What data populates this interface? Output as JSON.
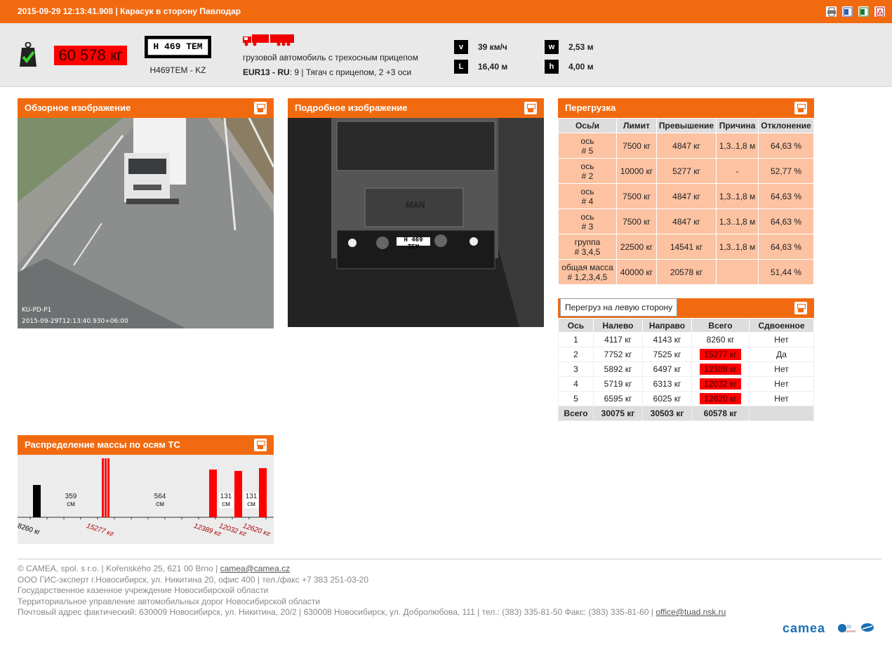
{
  "header": {
    "title": "2015-09-29 12:13:41.908 | Карасук в сторону Павлодар",
    "icons": [
      "print-icon",
      "word-icon",
      "excel-icon",
      "pdf-icon"
    ]
  },
  "vehicle": {
    "total_weight": "60 578 кг",
    "plate_text": "H 469 TEM",
    "plate_caption": "H469TEM - KZ",
    "type": "грузовой автомобиль с трехосным прицепом",
    "class_code": "EUR13 - RU",
    "class_desc": ": 9 | Тягач с прицепом, 2 +3 оси",
    "dims": {
      "v_key": "v",
      "v_val": "39 км/ч",
      "l_key": "L",
      "l_val": "16,40 м",
      "w_key": "w",
      "w_val": "2,53 м",
      "h_key": "h",
      "h_val": "4,00 м"
    }
  },
  "panels": {
    "overview_title": "Обзорное изображение",
    "detail_title": "Подробное изображение",
    "overload_title": "Перегрузка",
    "axle_title": "Перегруз на левую сторону",
    "distribution_title": "Распределение массы по осям ТС",
    "overview_overlay_1": "KU-PD-P1",
    "overview_overlay_2": "2015-09-29T12:13:40.930+06:00",
    "detail_plate": "H 469 TEM"
  },
  "overload_table": {
    "headers": [
      "Ось/и",
      "Лимит",
      "Превышение",
      "Причина",
      "Отклонение"
    ],
    "rows": [
      {
        "axle_1": "ось",
        "axle_2": "# 5",
        "limit": "7500 кг",
        "excess": "4847 кг",
        "reason": "1,3..1,8 м",
        "dev": "64,63 %"
      },
      {
        "axle_1": "ось",
        "axle_2": "# 2",
        "limit": "10000 кг",
        "excess": "5277 кг",
        "reason": "-",
        "dev": "52,77 %"
      },
      {
        "axle_1": "ось",
        "axle_2": "# 4",
        "limit": "7500 кг",
        "excess": "4847 кг",
        "reason": "1,3..1,8 м",
        "dev": "64,63 %"
      },
      {
        "axle_1": "ось",
        "axle_2": "# 3",
        "limit": "7500 кг",
        "excess": "4847 кг",
        "reason": "1,3..1,8 м",
        "dev": "64,63 %"
      },
      {
        "axle_1": "группа",
        "axle_2": "# 3,4,5",
        "limit": "22500 кг",
        "excess": "14541 кг",
        "reason": "1,3..1,8 м",
        "dev": "64,63 %"
      },
      {
        "axle_1": "общая масса",
        "axle_2": "# 1,2,3,4,5",
        "limit": "40000 кг",
        "excess": "20578 кг",
        "reason": "",
        "dev": "51,44 %"
      }
    ]
  },
  "axle_table": {
    "headers": [
      "Ось",
      "Налево",
      "Направо",
      "Всего",
      "Сдвоенное"
    ],
    "rows": [
      {
        "axle": "1",
        "left": "4117 кг",
        "right": "4143 кг",
        "total": "8260 кг",
        "twin": "Нет",
        "over": false
      },
      {
        "axle": "2",
        "left": "7752 кг",
        "right": "7525 кг",
        "total": "15277 кг",
        "twin": "Да",
        "over": true
      },
      {
        "axle": "3",
        "left": "5892 кг",
        "right": "6497 кг",
        "total": "12389 кг",
        "twin": "Нет",
        "over": true
      },
      {
        "axle": "4",
        "left": "5719 кг",
        "right": "6313 кг",
        "total": "12032 кг",
        "twin": "Нет",
        "over": true
      },
      {
        "axle": "5",
        "left": "6595 кг",
        "right": "6025 кг",
        "total": "12620 кг",
        "twin": "Нет",
        "over": true
      }
    ],
    "total_row": {
      "label": "Всего",
      "left": "30075 кг",
      "right": "30503 кг",
      "total": "60578 кг"
    }
  },
  "distribution": {
    "axles": [
      {
        "weight": "8260 кг",
        "position_cm": 0,
        "over": false
      },
      {
        "weight": "15277 кг",
        "position_cm": 359,
        "over": true
      },
      {
        "weight": "12389 кг",
        "position_cm": 923,
        "over": true
      },
      {
        "weight": "12032 кг",
        "position_cm": 1054,
        "over": true
      },
      {
        "weight": "12620 кг",
        "position_cm": 1185,
        "over": true
      }
    ],
    "gaps": [
      {
        "value": "359",
        "unit": "см"
      },
      {
        "value": "564",
        "unit": "см"
      },
      {
        "value": "131",
        "unit": "см"
      },
      {
        "value": "131",
        "unit": "см"
      }
    ],
    "colors": {
      "normal": "#000000",
      "over": "#ff0000"
    }
  },
  "footer": {
    "line1_text": "© CAMEA, spol. s r.o. | Kořenského 25, 621 00 Brno | ",
    "line1_link": "camea@camea.cz",
    "line2": "ООО ГИС-эксперт г.Новосибирск, ул. Никитина 20, офис 400 | тел./факс +7 383 251-03-20",
    "line3": "Государственное казенное учреждение Новосибирской области",
    "line4": "Территориальное управление автомобильных дорог Новосибирской области",
    "line5_text": "Почтовый адрес фактический: 630009 Новосибирск, ул. Никитина, 20/2 | 630008 Новосибирск, ул. Добролюбова, 111 | тел.: (383) 335-81-50 Факс: (383) 335-81-60 | ",
    "line5_link": "office@tuad.nsk.ru",
    "logo": "camea"
  },
  "colors": {
    "accent": "#f26a0f",
    "overload_bg": "#fcc2a2",
    "alert": "#ff0000"
  }
}
